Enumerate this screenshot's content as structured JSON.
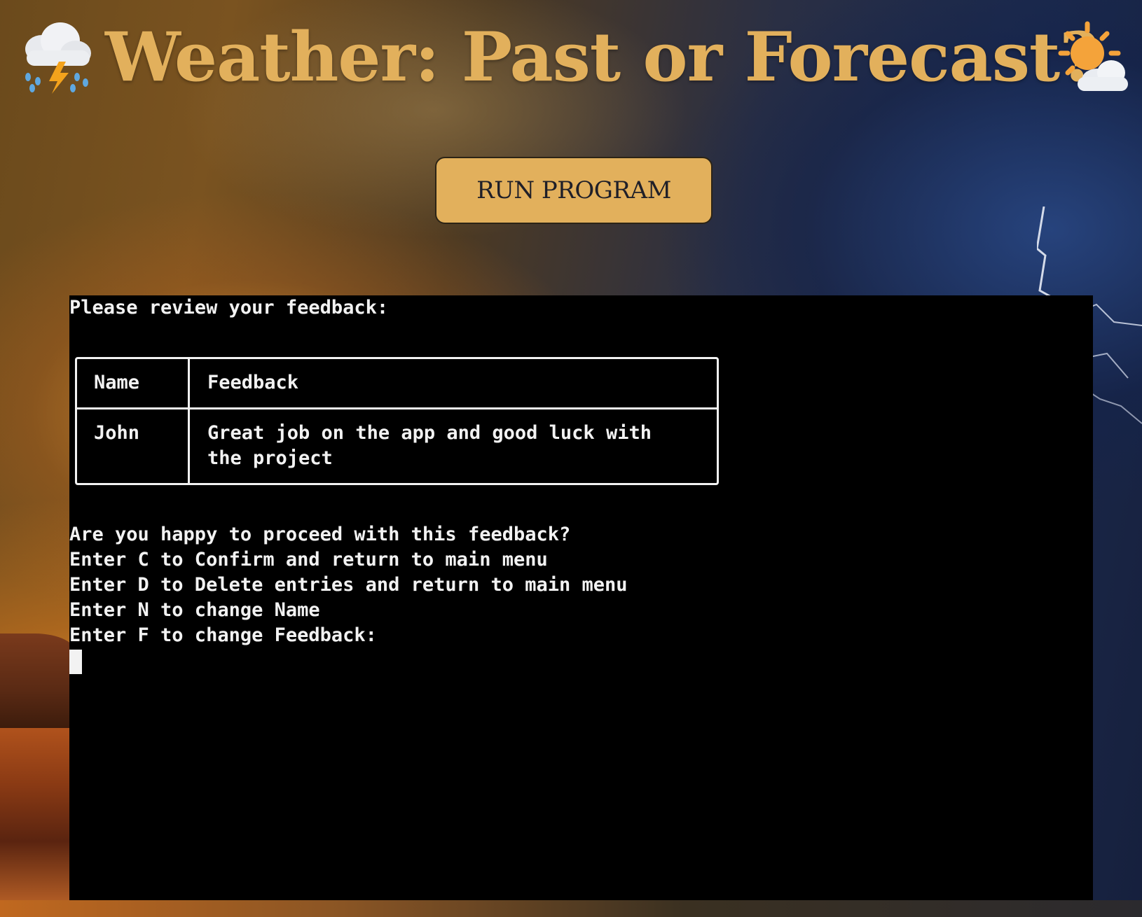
{
  "header": {
    "title": "Weather: Past or Forecast?",
    "left_icon": "thunderstorm-icon",
    "right_icon": "sun-behind-cloud-icon"
  },
  "run_button": {
    "label": "RUN PROGRAM"
  },
  "terminal": {
    "review_prompt": "Please review your feedback:",
    "table": {
      "headers": [
        "Name",
        "Feedback"
      ],
      "rows": [
        {
          "name": "John",
          "feedback_line1": "Great job on the app and good luck with",
          "feedback_line2": "the project"
        }
      ]
    },
    "question": "Are you happy to proceed with this feedback?",
    "options": [
      "Enter C to Confirm and return to main menu",
      "Enter D to Delete entries and return to main menu",
      "Enter N to change Name",
      "Enter F to change Feedback:"
    ]
  },
  "colors": {
    "accent_gold": "#e2b05c",
    "terminal_bg": "#000000",
    "terminal_text": "#f2f2f2"
  }
}
